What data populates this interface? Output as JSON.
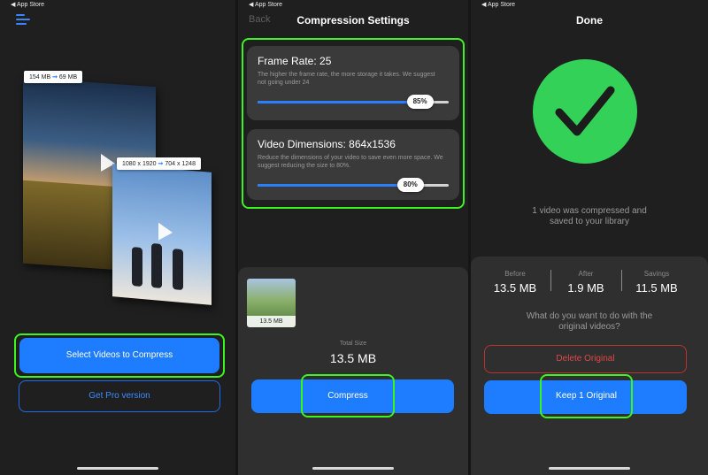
{
  "status_bar": {
    "back_app": "◀ App Store"
  },
  "screen1": {
    "menu_icon": "hamburger-icon",
    "tag1": {
      "from": "154 MB",
      "to": "69 MB"
    },
    "tag2": {
      "from": "1080 x 1920",
      "to": "704 x 1248"
    },
    "select_button": "Select Videos to Compress",
    "pro_button": "Get Pro version"
  },
  "screen2": {
    "back": "Back",
    "title": "Compression Settings",
    "frame_rate": {
      "title": "Frame Rate: 25",
      "description": "The higher the frame rate, the more storage it takes. We suggest not going under 24",
      "value_label": "85%",
      "value": 0.85
    },
    "dimensions": {
      "title": "Video Dimensions: 864x1536",
      "description": "Reduce the dimensions of your video to save even more space. We suggest reducing the size to 80%.",
      "value_label": "80%",
      "value": 0.8
    },
    "thumbnail_size": "13.5 MB",
    "total_size_label": "Total Size",
    "total_size": "13.5 MB",
    "compress_button": "Compress"
  },
  "screen3": {
    "title": "Done",
    "message_line1": "1 video was compressed and",
    "message_line2": "saved to your library",
    "stats": [
      {
        "label": "Before",
        "value": "13.5 MB"
      },
      {
        "label": "After",
        "value": "1.9 MB"
      },
      {
        "label": "Savings",
        "value": "11.5 MB"
      }
    ],
    "question_line1": "What do you want to do with the",
    "question_line2": "original videos?",
    "delete_button": "Delete Original",
    "keep_button": "Keep 1 Original"
  },
  "colors": {
    "accent_blue": "#1d7cff",
    "highlight_green": "#3cf51f",
    "success_green": "#33d157",
    "danger_red": "#e04848"
  }
}
